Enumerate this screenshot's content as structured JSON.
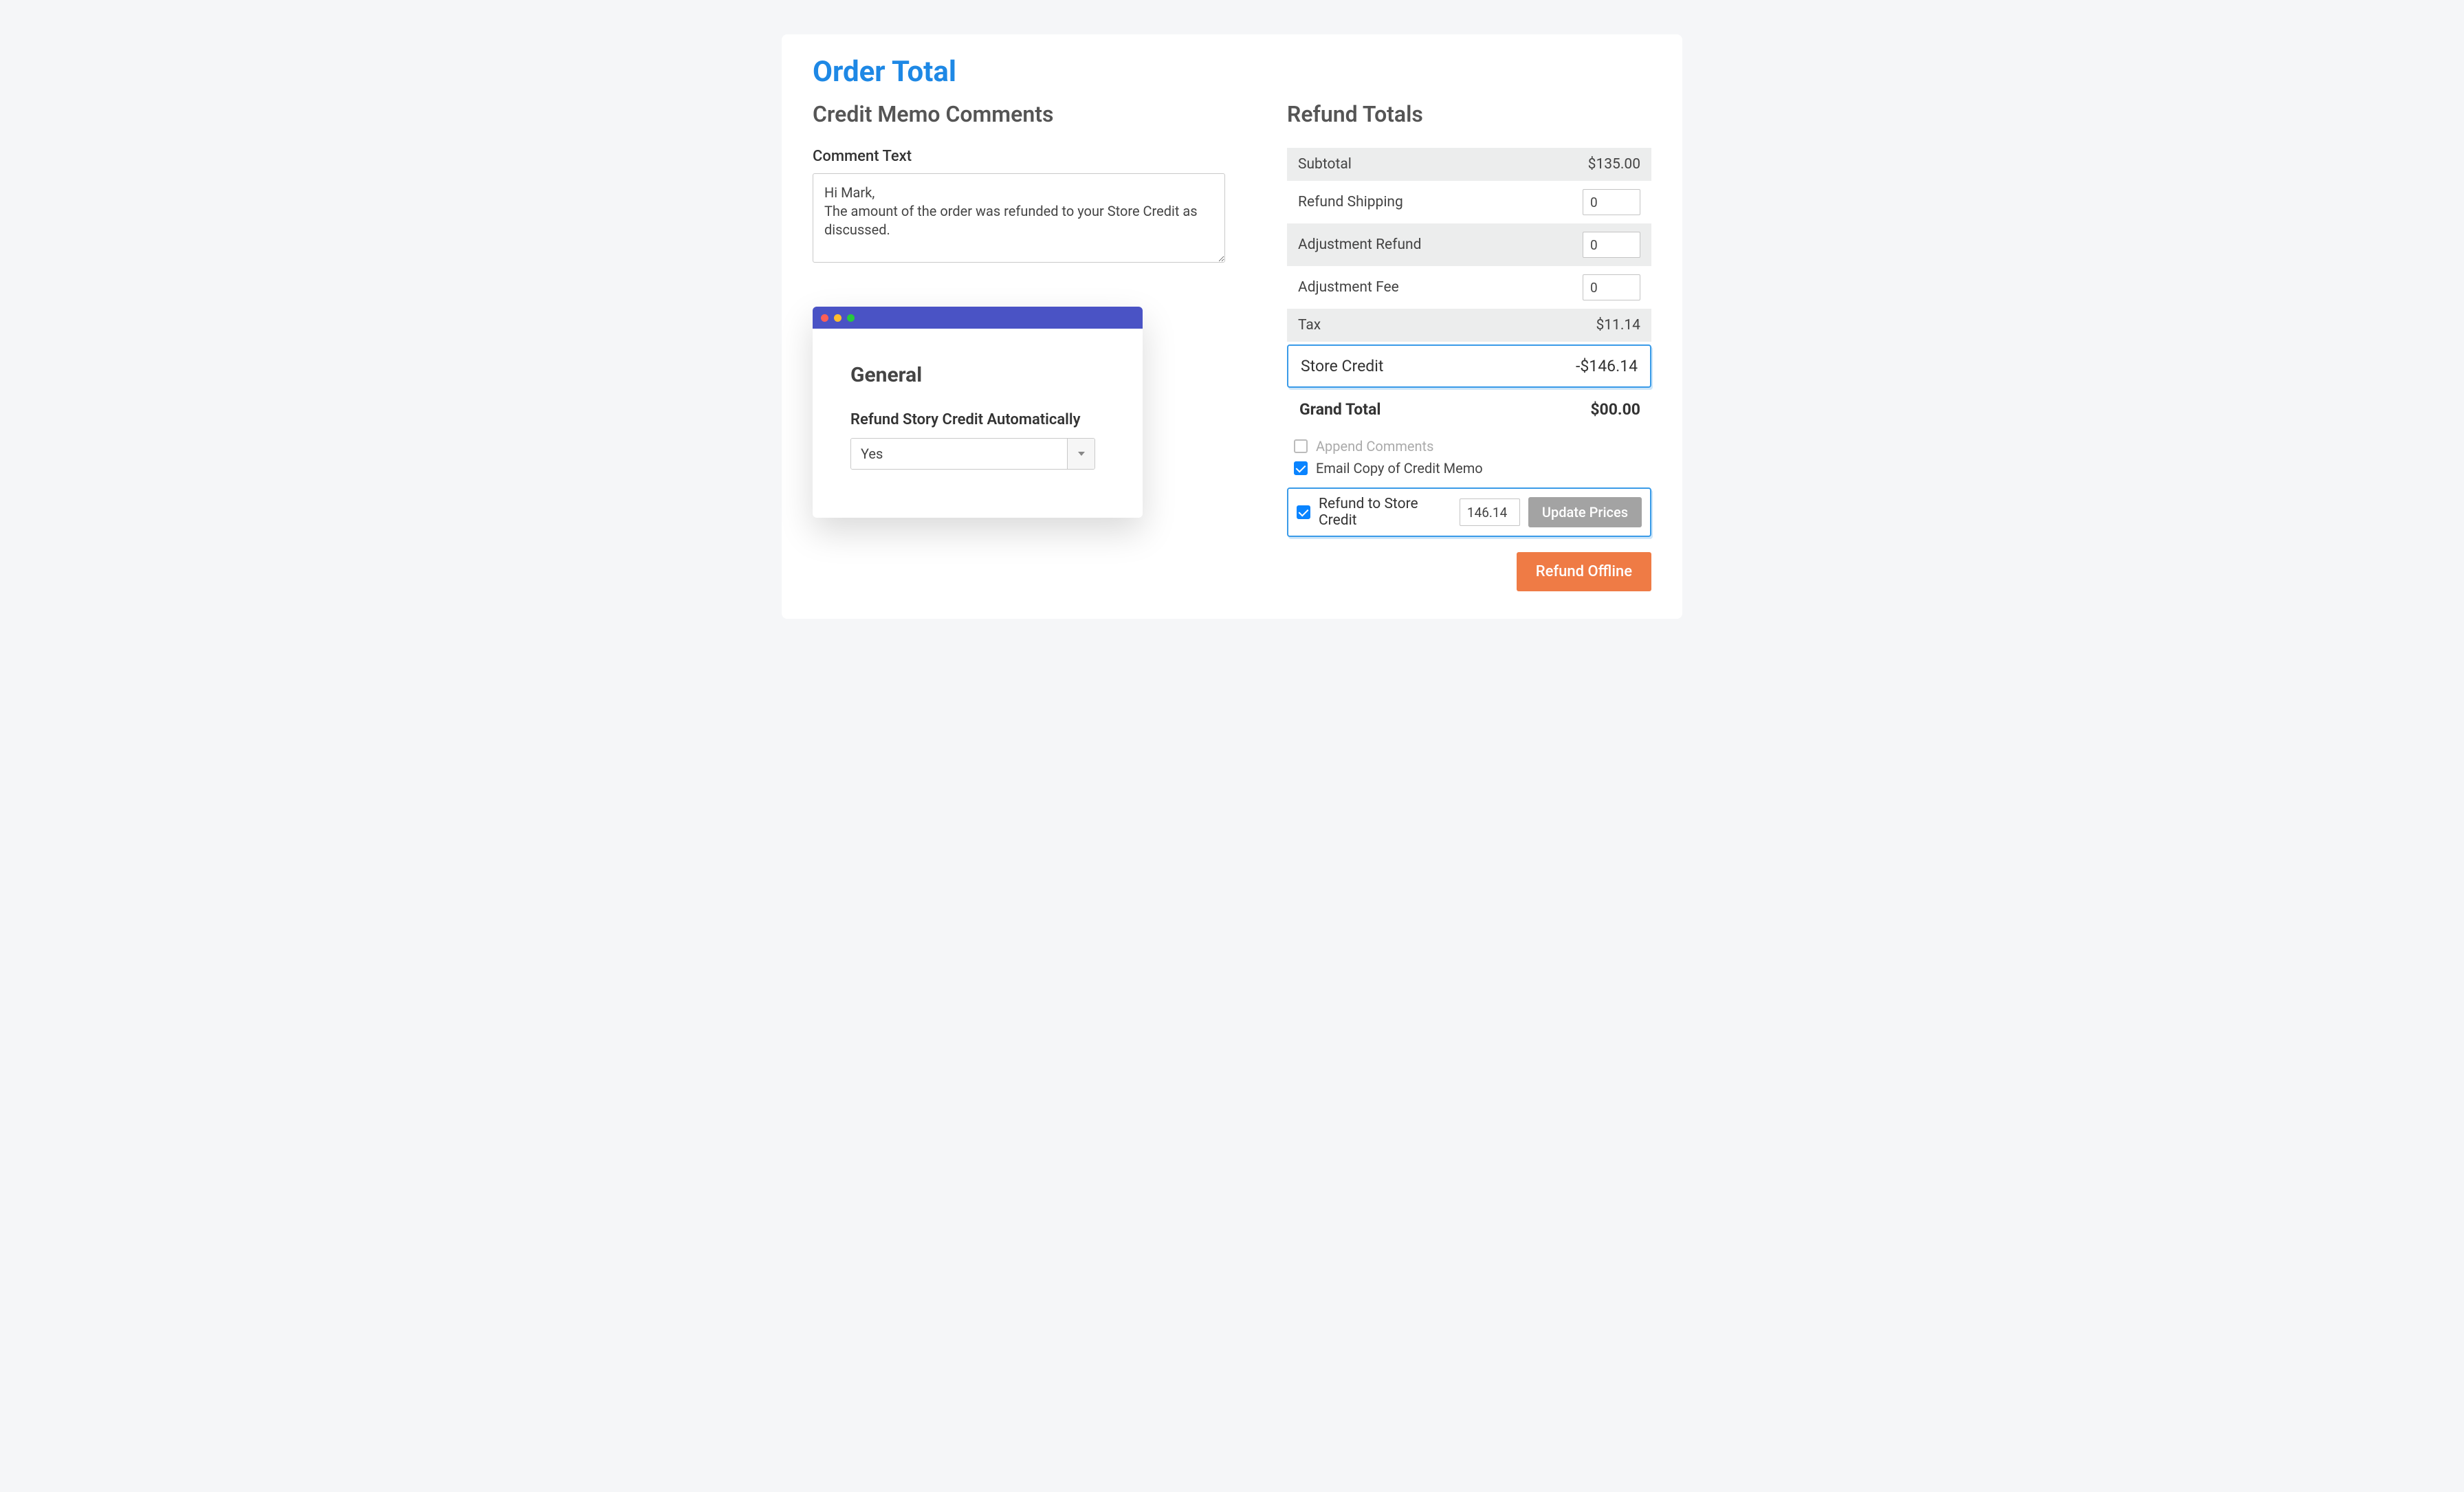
{
  "page": {
    "title": "Order Total"
  },
  "comments": {
    "section_title": "Credit Memo Comments",
    "label": "Comment Text",
    "text": "Hi Mark,\nThe amount of the order was refunded to your Store Credit as discussed."
  },
  "general_window": {
    "heading": "General",
    "label": "Refund Story Credit Automatically",
    "value": "Yes"
  },
  "refund": {
    "section_title": "Refund Totals",
    "subtotal_label": "Subtotal",
    "subtotal_value": "$135.00",
    "refund_shipping_label": "Refund Shipping",
    "refund_shipping_value": "0",
    "adjustment_refund_label": "Adjustment Refund",
    "adjustment_refund_value": "0",
    "adjustment_fee_label": "Adjustment Fee",
    "adjustment_fee_value": "0",
    "tax_label": "Tax",
    "tax_value": "$11.14",
    "store_credit_label": "Store Credit",
    "store_credit_value": "-$146.14",
    "grand_total_label": "Grand Total",
    "grand_total_value": "$00.00",
    "append_comments_label": "Append Comments",
    "email_copy_label": "Email Copy of Credit Memo",
    "refund_to_sc_label": "Refund to Store Credit",
    "refund_to_sc_value": "146.14",
    "update_prices_label": "Update Prices",
    "refund_offline_label": "Refund Offline"
  }
}
